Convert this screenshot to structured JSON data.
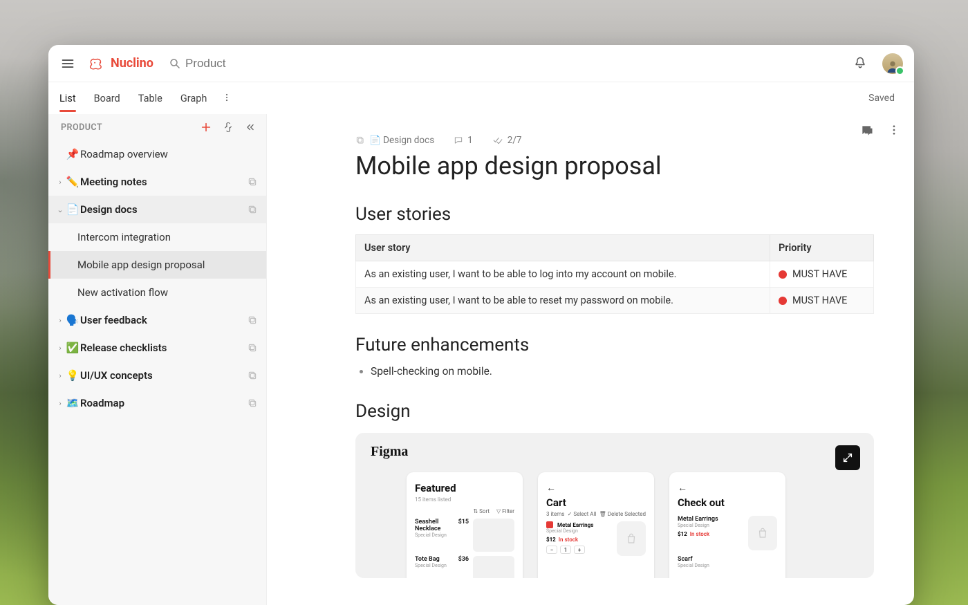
{
  "header": {
    "brand": "Nuclino",
    "search_placeholder": "Product",
    "saved_status": "Saved"
  },
  "tabs": {
    "items": [
      "List",
      "Board",
      "Table",
      "Graph"
    ],
    "active_index": 0
  },
  "sidebar": {
    "section_title": "PRODUCT",
    "nodes": [
      {
        "emoji": "📌",
        "label": "Roadmap overview",
        "leaf": true
      },
      {
        "emoji": "✏️",
        "label": "Meeting notes",
        "expandable": true,
        "copy": true
      },
      {
        "emoji": "📄",
        "label": "Design docs",
        "expandable": true,
        "expanded": true,
        "copy": true,
        "children": [
          {
            "label": "Intercom integration"
          },
          {
            "label": "Mobile app design proposal",
            "selected": true
          },
          {
            "label": "New activation flow"
          }
        ]
      },
      {
        "emoji": "🗣️",
        "label": "User feedback",
        "expandable": true,
        "copy": true
      },
      {
        "emoji": "✅",
        "label": "Release checklists",
        "expandable": true,
        "copy": true
      },
      {
        "emoji": "💡",
        "label": "UI/UX concepts",
        "expandable": true,
        "copy": true
      },
      {
        "emoji": "🗺️",
        "label": "Roadmap",
        "expandable": true,
        "copy": true
      }
    ]
  },
  "doc": {
    "breadcrumb": "📄 Design docs",
    "comment_count": "1",
    "task_progress": "2/7",
    "title": "Mobile app design proposal",
    "sections": {
      "user_stories_heading": "User stories",
      "user_stories_cols": [
        "User story",
        "Priority"
      ],
      "user_stories": [
        {
          "story": "As an existing user, I want to be able to log into my account on mobile.",
          "priority": "MUST HAVE"
        },
        {
          "story": "As an existing user, I want to be able to reset my password on mobile.",
          "priority": "MUST HAVE"
        }
      ],
      "future_heading": "Future enhancements",
      "future_items": [
        "Spell-checking on mobile."
      ],
      "design_heading": "Design",
      "figma_label": "Figma",
      "mocks": {
        "featured": {
          "title": "Featured",
          "subtitle": "15 items listed",
          "sort": "Sort",
          "filter": "Filter",
          "items": [
            {
              "name": "Seashell Necklace",
              "sub": "Special Design",
              "price": "$15"
            },
            {
              "name": "Tote Bag",
              "sub": "Special Design",
              "price": "$36"
            }
          ]
        },
        "cart": {
          "title": "Cart",
          "subtitle": "3 items",
          "select_all": "Select All",
          "delete": "Delete Selected",
          "item": {
            "name": "Metal Earrings",
            "sub": "Special Design",
            "price": "$12",
            "stock": "In stock"
          }
        },
        "checkout": {
          "title": "Check out",
          "items": [
            {
              "name": "Metal Earrings",
              "sub": "Special Design",
              "price": "$12",
              "stock": "In stock"
            },
            {
              "name": "Scarf",
              "sub": "Special Design"
            }
          ]
        }
      }
    }
  }
}
